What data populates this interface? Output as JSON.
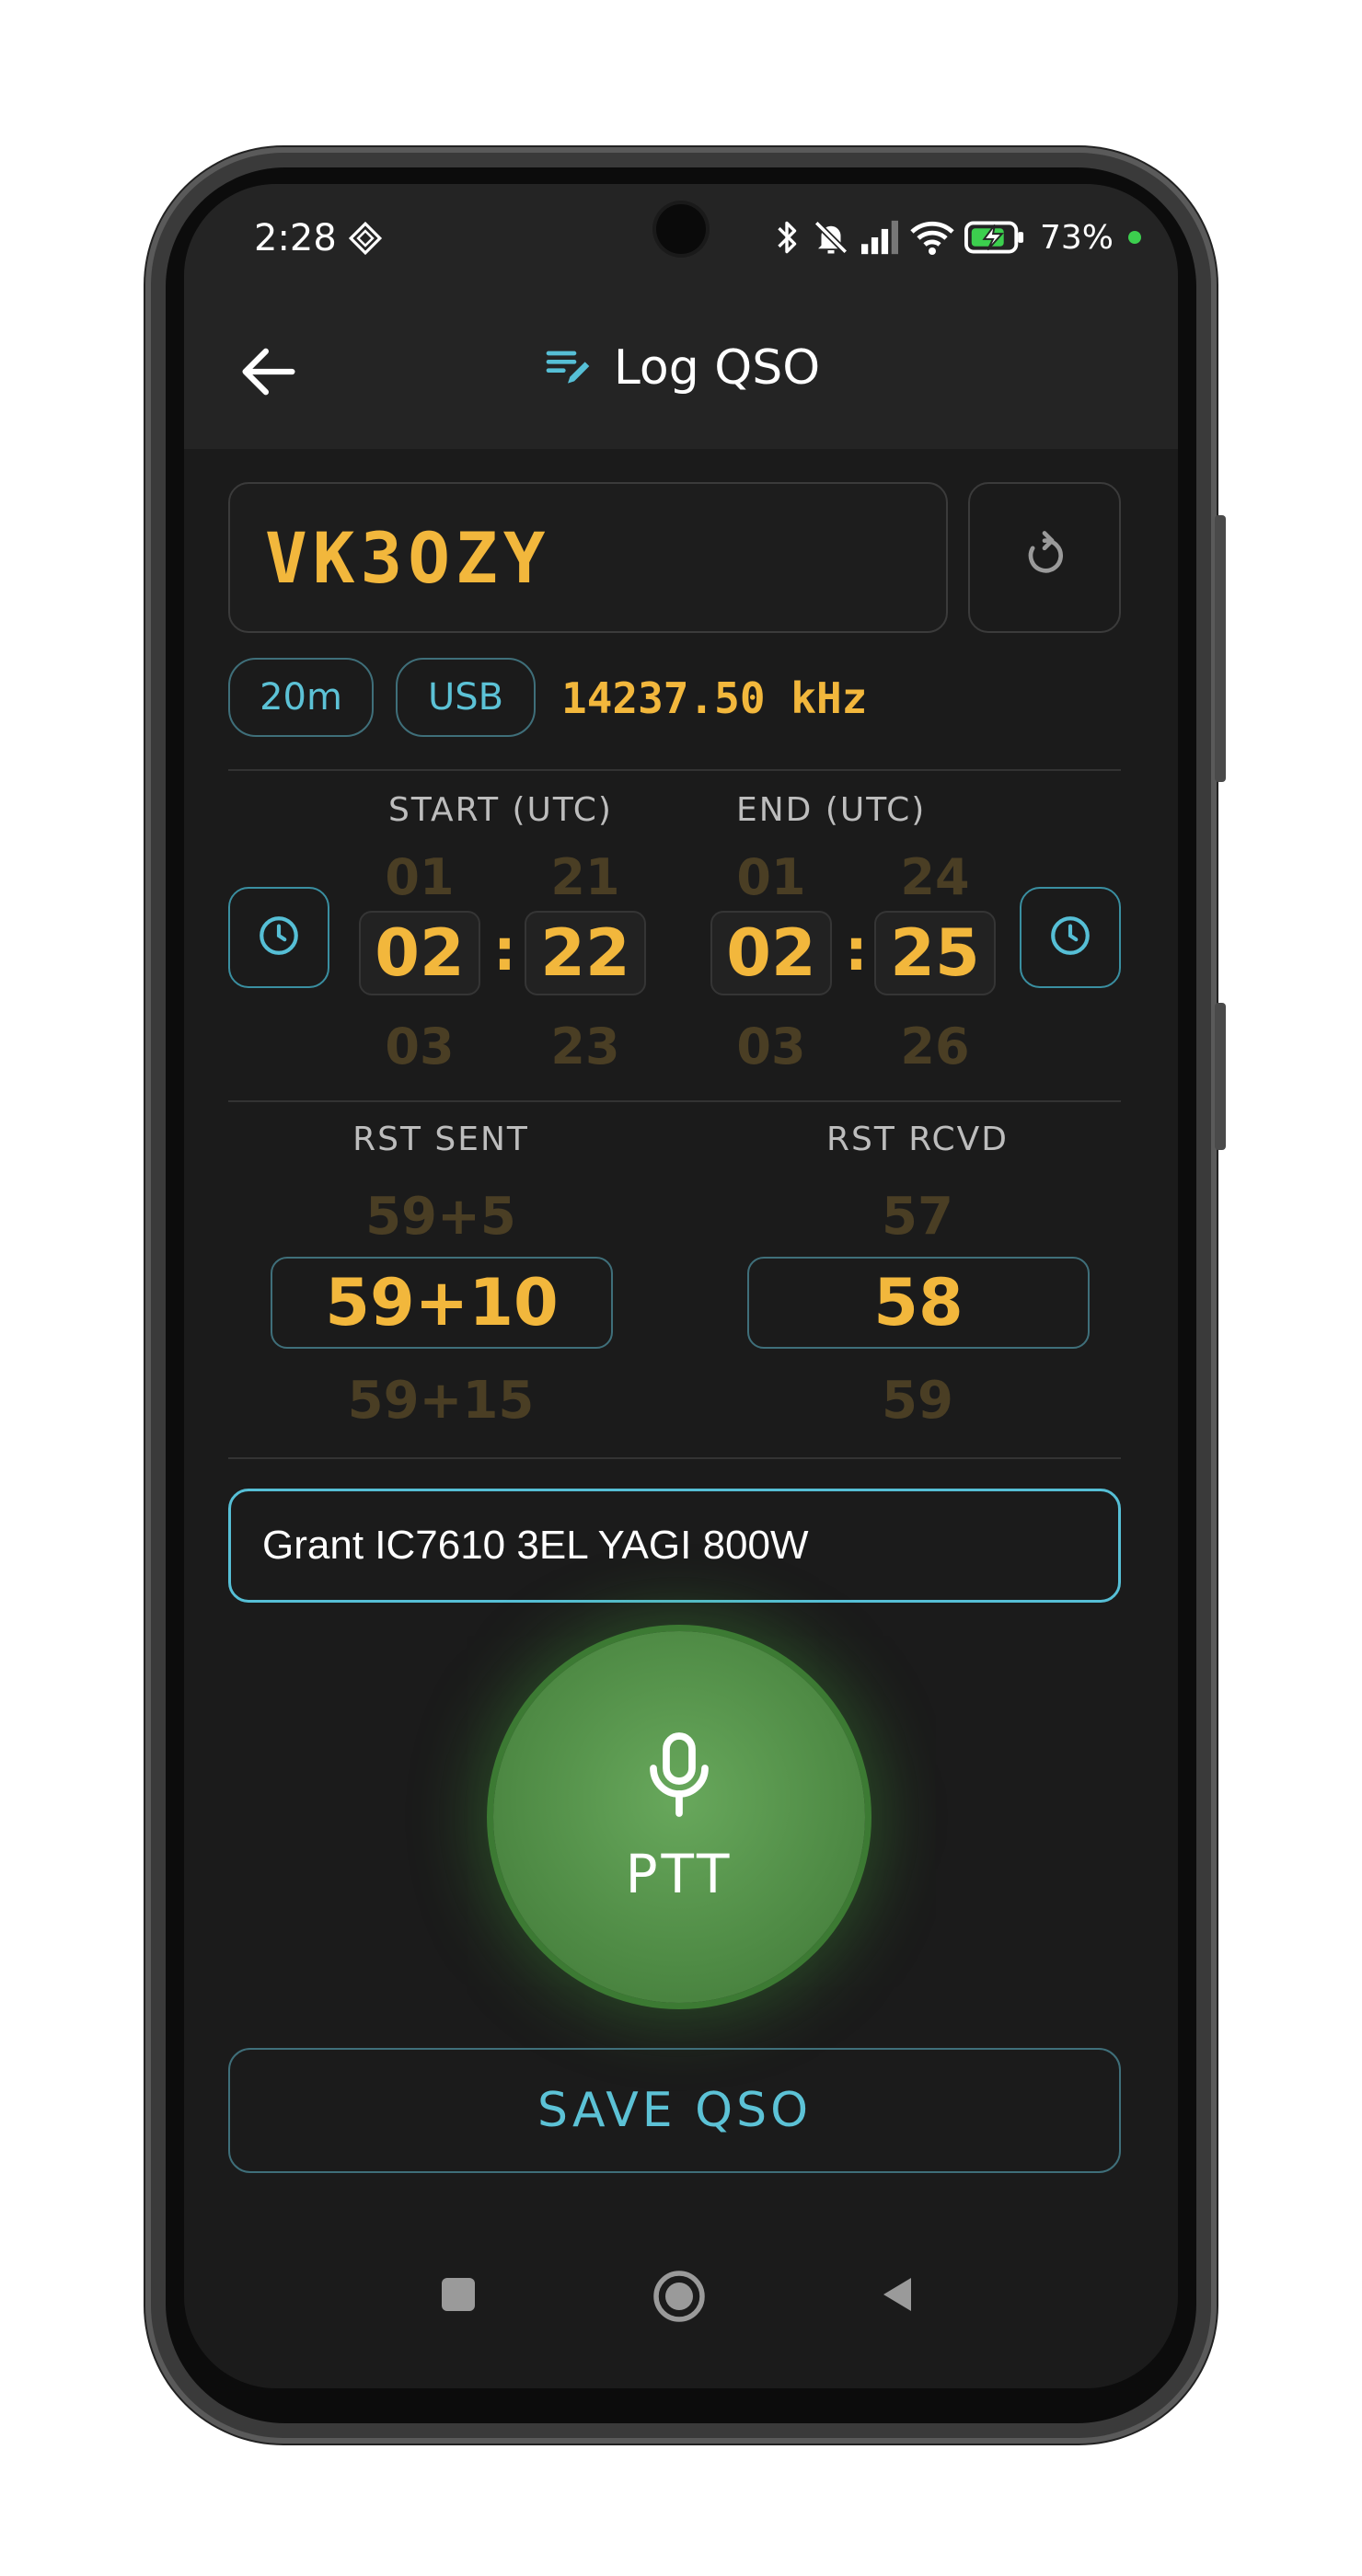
{
  "status_bar": {
    "time": "2:28",
    "battery": "73%"
  },
  "app_bar": {
    "title": "Log QSO"
  },
  "callsign": {
    "value": "VK3OZY"
  },
  "band_chip": "20m",
  "mode_chip": "USB",
  "frequency": "14237.50 kHz",
  "time_pickers": {
    "start_label": "START (UTC)",
    "end_label": "END (UTC)",
    "start": {
      "hour_prev": "01",
      "hour": "02",
      "hour_next": "03",
      "min_prev": "21",
      "min": "22",
      "min_next": "23"
    },
    "end": {
      "hour_prev": "01",
      "hour": "02",
      "hour_next": "03",
      "min_prev": "24",
      "min": "25",
      "min_next": "26"
    },
    "separator": ":"
  },
  "rst": {
    "sent_label": "RST SENT",
    "rcvd_label": "RST RCVD",
    "sent": {
      "prev": "59+5",
      "value": "59+10",
      "next": "59+15"
    },
    "rcvd": {
      "prev": "57",
      "value": "58",
      "next": "59"
    }
  },
  "notes": {
    "value": "Grant IC7610 3EL YAGI 800W"
  },
  "ptt": {
    "label": "PTT"
  },
  "save_button": {
    "label": "SAVE QSO"
  },
  "colors": {
    "accent_amber": "#f2b73c",
    "accent_cyan": "#5cc2d6",
    "ptt_green": "#4f8b45",
    "background": "#1b1b1b"
  }
}
